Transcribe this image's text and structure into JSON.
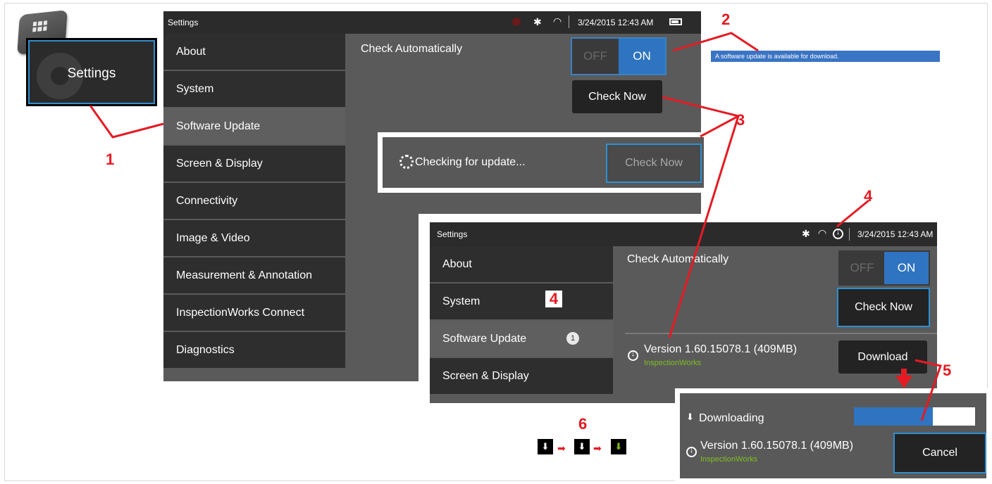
{
  "settings_tile": {
    "label": "Settings",
    "accent": "#2f8fd0"
  },
  "screen1": {
    "status": {
      "title": "Settings",
      "datetime": "3/24/2015 12:43 AM"
    },
    "sidebar": [
      {
        "label": "About"
      },
      {
        "label": "System"
      },
      {
        "label": "Software Update"
      },
      {
        "label": "Screen & Display"
      },
      {
        "label": "Connectivity"
      },
      {
        "label": "Image & Video"
      },
      {
        "label": "Measurement & Annotation"
      },
      {
        "label": "InspectionWorks Connect"
      },
      {
        "label": "Diagnostics"
      }
    ],
    "check_auto_label": "Check Automatically",
    "toggle": {
      "off": "OFF",
      "on": "ON"
    },
    "check_now": "Check Now"
  },
  "checking": {
    "text": "Checking for update...",
    "button": "Check Now"
  },
  "notification": {
    "text": "A software update is available for download.",
    "color": "#3a74c4"
  },
  "screen2": {
    "status": {
      "title": "Settings",
      "datetime": "3/24/2015 12:43 AM"
    },
    "sidebar": [
      {
        "label": "About"
      },
      {
        "label": "System"
      },
      {
        "label": "Software Update",
        "badge": "1"
      },
      {
        "label": "Screen & Display"
      }
    ],
    "check_auto_label": "Check Automatically",
    "toggle": {
      "off": "OFF",
      "on": "ON"
    },
    "check_now": "Check Now",
    "version": "Version 1.60.15078.1 (409MB)",
    "source": "InspectionWorks",
    "download": "Download"
  },
  "downloading": {
    "label": "Downloading",
    "progress": 0.65,
    "version": "Version 1.60.15078.1 (409MB)",
    "source": "InspectionWorks",
    "cancel": "Cancel"
  },
  "callouts": [
    "1",
    "2",
    "3",
    "4",
    "4",
    "5",
    "6"
  ],
  "colors": {
    "callout": "#e41b23",
    "accent_blue": "#2f74c0",
    "green": "#7fbf1f"
  }
}
